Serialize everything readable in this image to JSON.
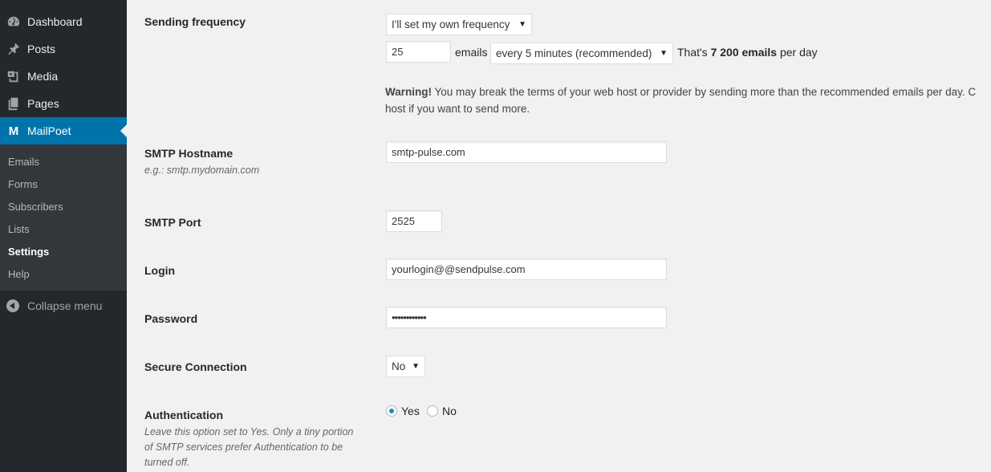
{
  "sidebar": {
    "items": [
      {
        "label": "Dashboard",
        "icon": "dashboard-icon"
      },
      {
        "label": "Posts",
        "icon": "pushpin-icon"
      },
      {
        "label": "Media",
        "icon": "media-icon"
      },
      {
        "label": "Pages",
        "icon": "pages-icon"
      },
      {
        "label": "MailPoet",
        "icon": "mailpoet-icon",
        "logo_text": "M"
      }
    ],
    "submenu": [
      "Emails",
      "Forms",
      "Subscribers",
      "Lists",
      "Settings",
      "Help"
    ],
    "current_submenu": "Settings",
    "collapse_label": "Collapse menu"
  },
  "settings": {
    "frequency": {
      "label": "Sending frequency",
      "mode_selected": "I'll set my own frequency",
      "count_value": "25",
      "count_unit": "emails",
      "interval_selected": "every 5 minutes (recommended)",
      "summary_prefix": "That's",
      "summary_bold": "7 200 emails",
      "summary_suffix": "per day",
      "warning_bold": "Warning!",
      "warning_line1": "You may break the terms of your web host or provider by sending more than the recommended emails per day. C",
      "warning_line2": "host if you want to send more."
    },
    "hostname": {
      "label": "SMTP Hostname",
      "hint": "e.g.: smtp.mydomain.com",
      "value": "smtp-pulse.com"
    },
    "port": {
      "label": "SMTP Port",
      "value": "2525"
    },
    "login": {
      "label": "Login",
      "value": "yourlogin@@sendpulse.com"
    },
    "password": {
      "label": "Password",
      "masked": "••••••••••••"
    },
    "secure": {
      "label": "Secure Connection",
      "selected": "No"
    },
    "authentication": {
      "label": "Authentication",
      "hint_line1": "Leave this option set to Yes. Only a tiny portion",
      "hint_line2": "of SMTP services prefer Authentication to be",
      "hint_line3": "turned off.",
      "options": [
        "Yes",
        "No"
      ],
      "selected": "Yes"
    }
  },
  "colors": {
    "sidebar_bg": "#23282d",
    "submenu_bg": "#32373c",
    "accent": "#0073aa",
    "radio": "#1e8cbe"
  }
}
